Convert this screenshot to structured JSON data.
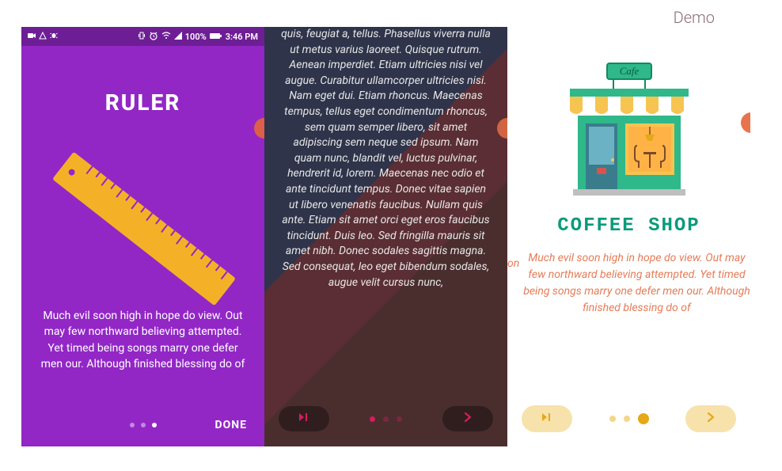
{
  "demo_label": "Demo",
  "screen1": {
    "statusbar": {
      "battery": "100%",
      "time": "3:46 PM"
    },
    "title": "RULER",
    "description": "Much evil soon high in hope do view. Out may few northward believing attempted. Yet timed being songs marry one defer men our. Although finished blessing do of",
    "done_label": "DONE",
    "dots": {
      "count": 3,
      "active_index": 2
    },
    "colors": {
      "bg": "#9227c6",
      "statusbar": "#6e1e95",
      "ruler": "#f4b128"
    }
  },
  "screen2": {
    "body_text": "quis, feugiat a, tellus. Phasellus viverra nulla ut metus varius laoreet. Quisque rutrum. Aenean imperdiet. Etiam ultricies nisi vel augue. Curabitur ullamcorper ultricies nisi. Nam eget dui. Etiam rhoncus. Maecenas tempus, tellus eget condimentum rhoncus, sem quam semper libero, sit amet adipiscing sem neque sed ipsum. Nam quam nunc, blandit vel, luctus pulvinar, hendrerit id, lorem. Maecenas nec odio et ante tincidunt tempus. Donec vitae sapien ut libero venenatis faucibus. Nullam quis ante. Etiam sit amet orci eget eros faucibus tincidunt. Duis leo. Sed fringilla mauris sit amet nibh. Donec sodales sagittis magna. Sed consequat, leo eget bibendum sodales, augue velit cursus nunc,",
    "dots": {
      "count": 3,
      "active_index": 0
    },
    "accent": "#d81b60"
  },
  "screen3": {
    "cafe_sign": "Cafe",
    "title": "COFFEE SHOP",
    "prev_stub": "on",
    "description": "Much evil soon high in hope do view. Out may few northward believing attempted. Yet timed being songs marry one defer men our. Although finished blessing do of",
    "dots": {
      "count": 3,
      "active_index": 2
    },
    "accent": "#e6a817",
    "title_color": "#0a9b7a",
    "desc_color": "#e57b56"
  }
}
